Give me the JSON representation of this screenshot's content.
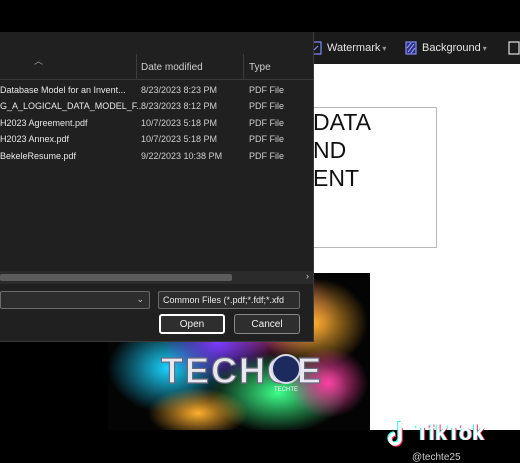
{
  "toolbar": {
    "watermark_label": "Watermark",
    "background_label": "Background"
  },
  "dialog": {
    "columns": {
      "date": "Date modified",
      "type": "Type"
    },
    "files": [
      {
        "name": "Database Model for an Invent...",
        "date": "8/23/2023 8:23 PM",
        "type": "PDF File"
      },
      {
        "name": "G_A_LOGICAL_DATA_MODEL_F...",
        "date": "8/23/2023 8:12 PM",
        "type": "PDF File"
      },
      {
        "name": "H2023 Agreement.pdf",
        "date": "10/7/2023 5:18 PM",
        "type": "PDF File"
      },
      {
        "name": "H2023 Annex.pdf",
        "date": "10/7/2023 5:18 PM",
        "type": "PDF File"
      },
      {
        "name": "BekeleResume.pdf",
        "date": "9/22/2023 10:38 PM",
        "type": "PDF File"
      }
    ],
    "filetype_filter": "Common Files (*.pdf;*.fdf;*.xfd",
    "open_label": "Open",
    "cancel_label": "Cancel"
  },
  "document": {
    "heading_lines": [
      "DATA",
      "ND",
      "ENT"
    ],
    "image_text": "TECHOE",
    "image_logo_text": "TECHTE"
  },
  "overlay": {
    "tiktok_label": "TikTok",
    "handle": "@techte25"
  },
  "colors": {
    "toolbar_bg": "#1b1b1b",
    "dialog_bg": "#202020",
    "help_icon": "#3b82f6",
    "toolbar_icon": "#6b7cff"
  },
  "icons": [
    "view-icon",
    "help-icon",
    "watermark-icon",
    "background-icon",
    "doc-icon",
    "tiktok-logo-icon"
  ]
}
